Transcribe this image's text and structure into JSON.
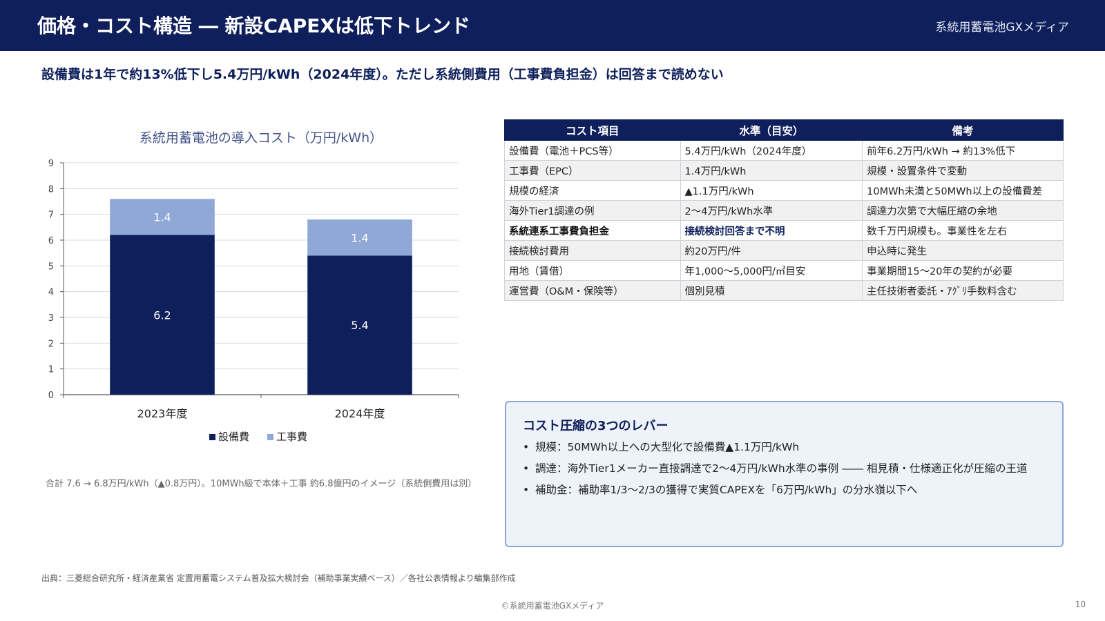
{
  "header": {
    "title": "価格・コスト構造 ― 新設CAPEXは低下トレンド",
    "brand": "系統用蓄電池GXメディア"
  },
  "subtitle": "設備費は1年で約13%低下し5.4万円/kWh（2024年度）。ただし系統側費用（工事費負担金）は回答まで読めない",
  "chart_data": {
    "type": "bar",
    "stacked": true,
    "title": "系統用蓄電池の導入コスト（万円/kWh）",
    "xlabel": "",
    "ylabel": "",
    "categories": [
      "2023年度",
      "2024年度"
    ],
    "series": [
      {
        "name": "設備費",
        "values": [
          6.2,
          5.4
        ],
        "color": "#0e1f5b"
      },
      {
        "name": "工事費",
        "values": [
          1.4,
          1.4
        ],
        "color": "#8fa8d6"
      }
    ],
    "ylim": [
      0,
      9
    ],
    "yticks": [
      "0",
      "1",
      "2",
      "3",
      "4",
      "5",
      "6",
      "7",
      "8",
      "9"
    ],
    "grid": true,
    "legend_position": "bottom"
  },
  "chart_note": "合計 7.6 → 6.8万円/kWh（▲0.8万円）。10MWh級で本体＋工事 約6.8億円のイメージ（系統側費用は別）",
  "table": {
    "headers": [
      "コスト項目",
      "水準（目安）",
      "備考"
    ],
    "rows": [
      {
        "item": "設備費（電池＋PCS等）",
        "level": "5.4万円/kWh（2024年度）",
        "note": "前年6.2万円/kWh → 約13%低下"
      },
      {
        "item": "工事費（EPC）",
        "level": "1.4万円/kWh",
        "note": "規模・設置条件で変動"
      },
      {
        "item": "規模の経済",
        "level": "▲1.1万円/kWh",
        "note": "10MWh未満と50MWh以上の設備費差"
      },
      {
        "item": "海外Tier1調達の例",
        "level": "2〜4万円/kWh水準",
        "note": "調達力次第で大幅圧縮の余地"
      },
      {
        "item": "系統連系工事費負担金",
        "level": "接続検討回答まで不明",
        "note": "数千万円規模も。事業性を左右"
      },
      {
        "item": "接続検討費用",
        "level": "約20万円/件",
        "note": "申込時に発生"
      },
      {
        "item": "用地（賃借）",
        "level": "年1,000〜5,000円/㎡目安",
        "note": "事業期間15〜20年の契約が必要"
      },
      {
        "item": "運営費（O&M・保険等）",
        "level": "個別見積",
        "note": "主任技術者委託・ｱｸﾞﾘ手数料含む"
      }
    ]
  },
  "levers": {
    "title": "コスト圧縮の3つのレバー",
    "bullet": "•",
    "items": [
      "規模：50MWh以上への大型化で設備費▲1.1万円/kWh",
      "調達：海外Tier1メーカー直接調達で2〜4万円/kWh水準の事例 ―― 相見積・仕様適正化が圧縮の王道",
      "補助金：補助率1/3〜2/3の獲得で実質CAPEXを「6万円/kWh」の分水嶺以下へ"
    ]
  },
  "source": "出典：三菱総合研究所・経済産業省 定置用蓄電システム普及拡大検討会（補助事業実績ベース）／各社公表情報より編集部作成",
  "footer": {
    "copyright": "©系統用蓄電池GXメディア",
    "page": "10"
  }
}
